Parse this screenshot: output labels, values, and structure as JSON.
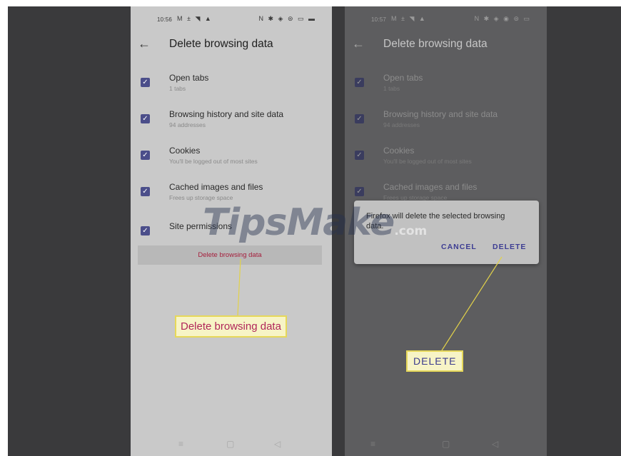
{
  "watermark": {
    "brand": "TipsMake",
    "suffix": ".com"
  },
  "left_screen": {
    "status": {
      "time": "10:56",
      "icons_left": "M ± ◥ ▲",
      "icons_right": "N ✱ ◈ ⊜ ▭ ▬"
    },
    "title": "Delete browsing data",
    "items": [
      {
        "label": "Open tabs",
        "sub": "1 tabs"
      },
      {
        "label": "Browsing history and site data",
        "sub": "94 addresses"
      },
      {
        "label": "Cookies",
        "sub": "You'll be logged out of most sites"
      },
      {
        "label": "Cached images and files",
        "sub": "Frees up storage space"
      },
      {
        "label": "Site permissions",
        "sub": ""
      }
    ],
    "delete_button": "Delete browsing data",
    "nav": [
      "≡",
      "▢",
      "◁"
    ]
  },
  "right_screen": {
    "status": {
      "time": "10:57",
      "icons_left": "M ± ◥ ▲",
      "icons_right": "N ✱ ◈ ◉ ⊜ ▭"
    },
    "title": "Delete browsing data",
    "items": [
      {
        "label": "Open tabs",
        "sub": "1 tabs"
      },
      {
        "label": "Browsing history and site data",
        "sub": "94 addresses"
      },
      {
        "label": "Cookies",
        "sub": "You'll be logged out of most sites"
      },
      {
        "label": "Cached images and files",
        "sub": "Frees up storage space"
      }
    ],
    "nav": [
      "≡",
      "▢",
      "◁"
    ]
  },
  "dialog": {
    "message": "Firefox will delete the selected browsing data.",
    "cancel": "CANCEL",
    "delete": "DELETE"
  },
  "callouts": {
    "left": "Delete browsing data",
    "right": "DELETE"
  },
  "icons": {
    "back": "←",
    "check": "✓"
  },
  "colors": {
    "accent": "#4b4e8a",
    "delete_text": "#a51e3c",
    "dialog_button": "#3d3d93",
    "callout_bg": "#f7f4c6",
    "callout_border": "#e6d85a",
    "callout_line": "#e2d24a"
  }
}
